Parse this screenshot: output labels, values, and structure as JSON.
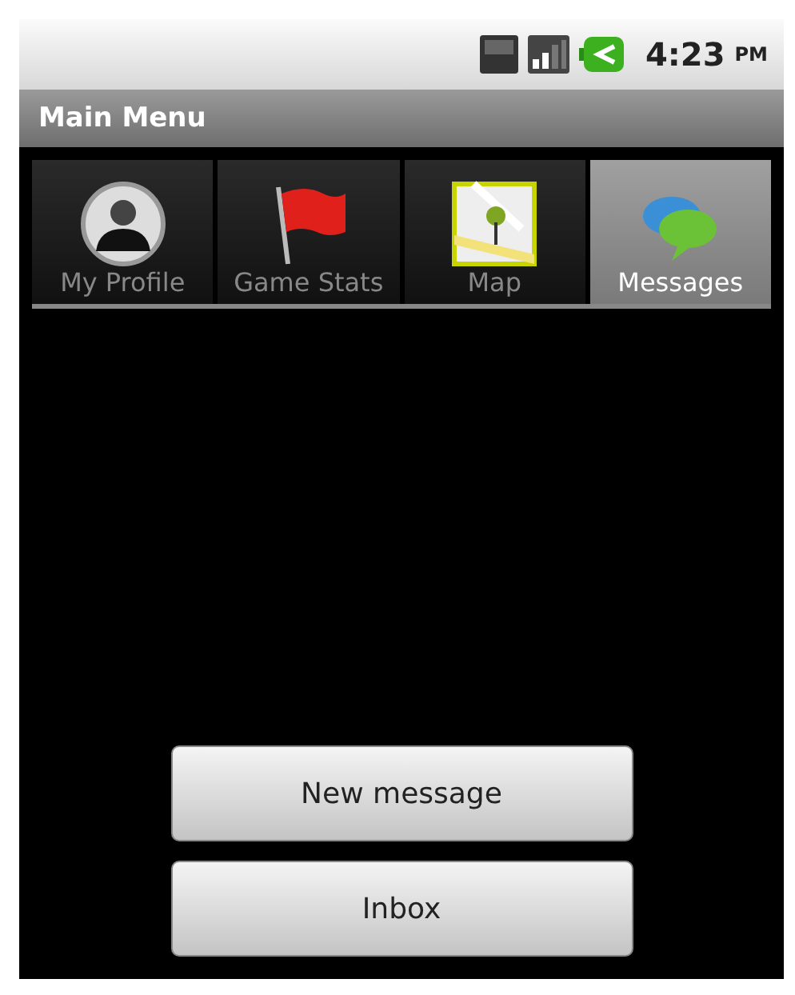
{
  "status_bar": {
    "time": "4:23",
    "meridiem": "PM"
  },
  "title_bar": {
    "title": "Main Menu"
  },
  "tabs": [
    {
      "label": "My Profile",
      "kind": "person",
      "selected": false
    },
    {
      "label": "Game Stats",
      "kind": "flag",
      "selected": false
    },
    {
      "label": "Map",
      "kind": "map",
      "selected": false
    },
    {
      "label": "Messages",
      "kind": "chat",
      "selected": true
    }
  ],
  "buttons": [
    "New message",
    "Inbox"
  ]
}
